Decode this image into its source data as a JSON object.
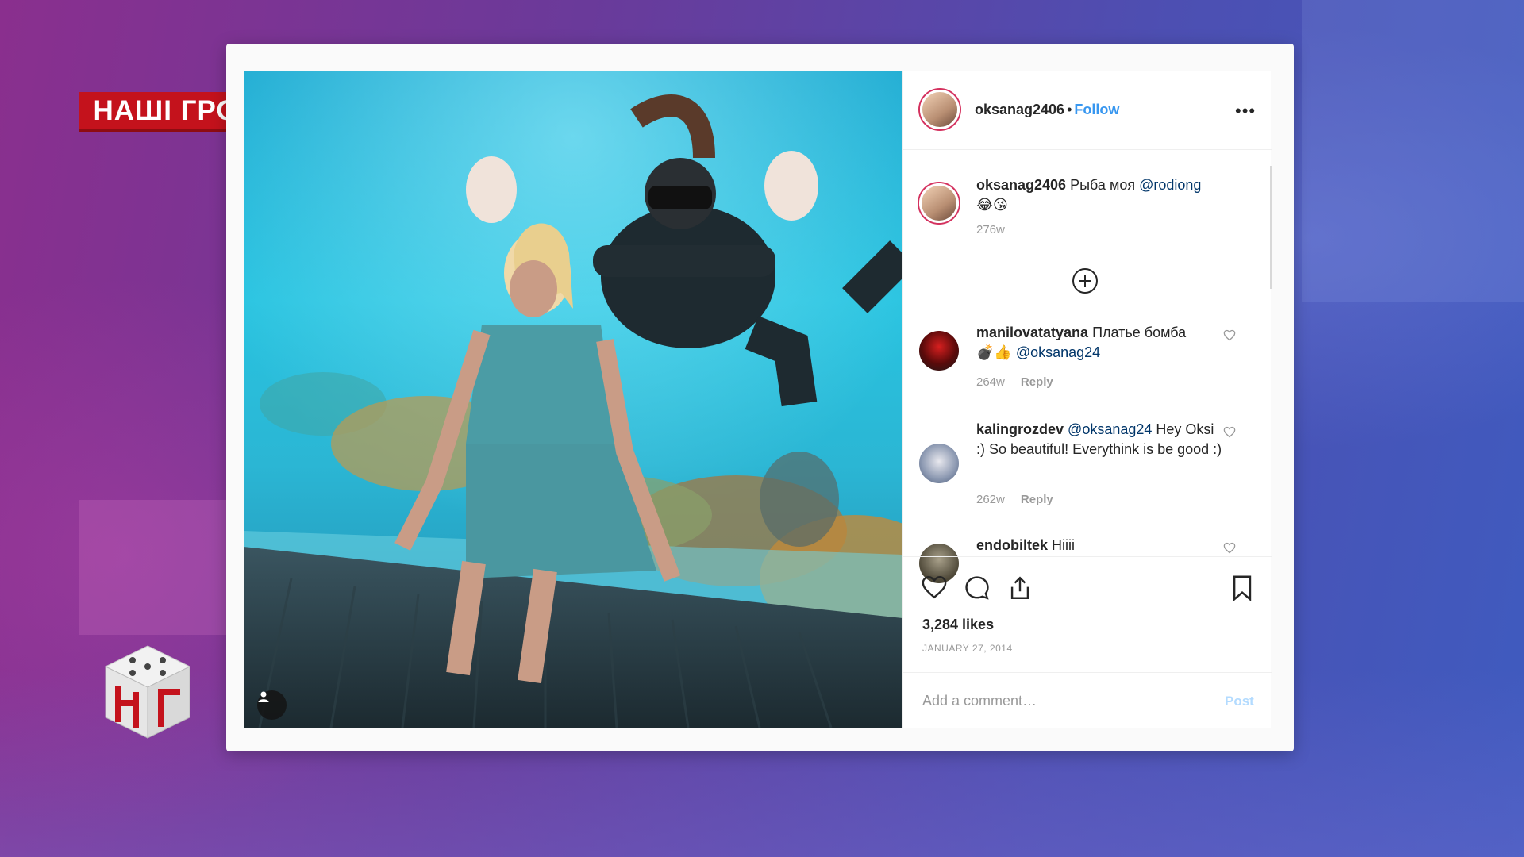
{
  "overlay": {
    "badge_text": "НАШІ ГРОШІ"
  },
  "post": {
    "username": "oksanag2406",
    "separator": "•",
    "follow_label": "Follow",
    "more_icon": "more-horizontal-icon",
    "caption": {
      "username": "oksanag2406",
      "text": "Рыба моя",
      "mention": "@rodiong",
      "emoji": "😂😘",
      "time": "276w"
    },
    "load_more_icon": "plus-circle-icon",
    "comments": [
      {
        "username": "manilovatatyana",
        "text": "Платье бомба",
        "line2": "💣👍",
        "mention": "@oksanag24",
        "time": "264w",
        "reply_label": "Reply"
      },
      {
        "username": "kalingrozdev",
        "mention": "@oksanag24",
        "text": "Hey Oksi :) So beautiful! Everythink is be good :)",
        "time": "262w",
        "reply_label": "Reply"
      },
      {
        "username": "endobiltek",
        "text": "Hiiii"
      }
    ],
    "likes": "3,284 likes",
    "date": "JANUARY 27, 2014",
    "comment_placeholder": "Add a comment…",
    "post_label": "Post"
  },
  "colors": {
    "badge_red": "#c4121c",
    "link_blue": "#3897f0",
    "mention_blue": "#003569",
    "muted_gray": "#999999"
  }
}
